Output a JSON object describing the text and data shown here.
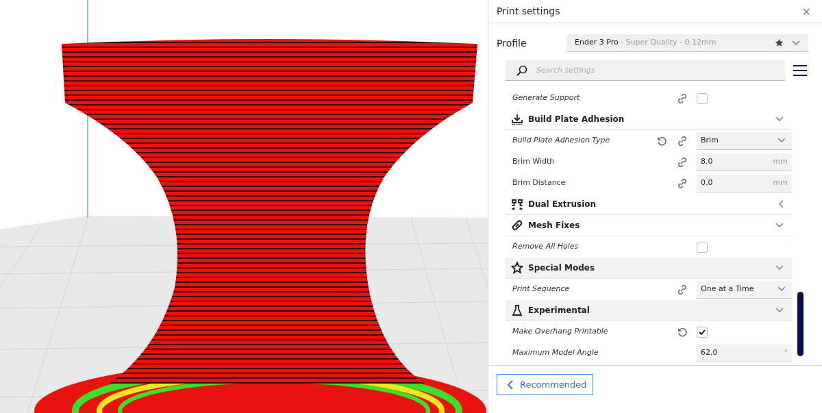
{
  "panel": {
    "title": "Print settings",
    "close": "×"
  },
  "profile": {
    "label": "Profile",
    "name": "Ender 3 Pro",
    "detail": " - Super Quality - 0.12mm"
  },
  "search": {
    "placeholder": "Search settings"
  },
  "rows": [
    {
      "kind": "setting",
      "label": "Generate Support",
      "emphasized": true,
      "linked": true,
      "resettable": false,
      "control": {
        "kind": "checkbox",
        "checked": false
      }
    },
    {
      "kind": "category",
      "label": "Build Plate Adhesion",
      "expanded": true,
      "highlighted": false
    },
    {
      "kind": "setting",
      "label": "Build Plate Adhesion Type",
      "emphasized": true,
      "linked": true,
      "resettable": true,
      "control": {
        "kind": "dropdown",
        "value": "Brim"
      }
    },
    {
      "kind": "setting",
      "label": "Brim Width",
      "emphasized": false,
      "linked": true,
      "resettable": false,
      "control": {
        "kind": "number",
        "value": "8.0",
        "unit": "mm"
      }
    },
    {
      "kind": "setting",
      "label": "Brim Distance",
      "emphasized": false,
      "linked": true,
      "resettable": false,
      "control": {
        "kind": "number",
        "value": "0.0",
        "unit": "mm"
      }
    },
    {
      "kind": "category",
      "label": "Dual Extrusion",
      "expanded": false,
      "highlighted": false
    },
    {
      "kind": "category",
      "label": "Mesh Fixes",
      "expanded": true,
      "highlighted": false
    },
    {
      "kind": "setting",
      "label": "Remove All Holes",
      "emphasized": true,
      "linked": false,
      "resettable": false,
      "control": {
        "kind": "checkbox",
        "checked": false
      }
    },
    {
      "kind": "category",
      "label": "Special Modes",
      "expanded": true,
      "highlighted": true
    },
    {
      "kind": "setting",
      "label": "Print Sequence",
      "emphasized": true,
      "linked": true,
      "resettable": false,
      "control": {
        "kind": "dropdown",
        "value": "One at a Time"
      }
    },
    {
      "kind": "category",
      "label": "Experimental",
      "expanded": true,
      "highlighted": true
    },
    {
      "kind": "setting",
      "label": "Make Overhang Printable",
      "emphasized": true,
      "linked": false,
      "resettable": true,
      "control": {
        "kind": "checkbox",
        "checked": true
      }
    },
    {
      "kind": "setting",
      "label": "Maximum Model Angle",
      "emphasized": true,
      "linked": false,
      "resettable": false,
      "control": {
        "kind": "number",
        "value": "62.0",
        "unit": "°"
      }
    }
  ],
  "footer": {
    "button": "Recommended"
  }
}
